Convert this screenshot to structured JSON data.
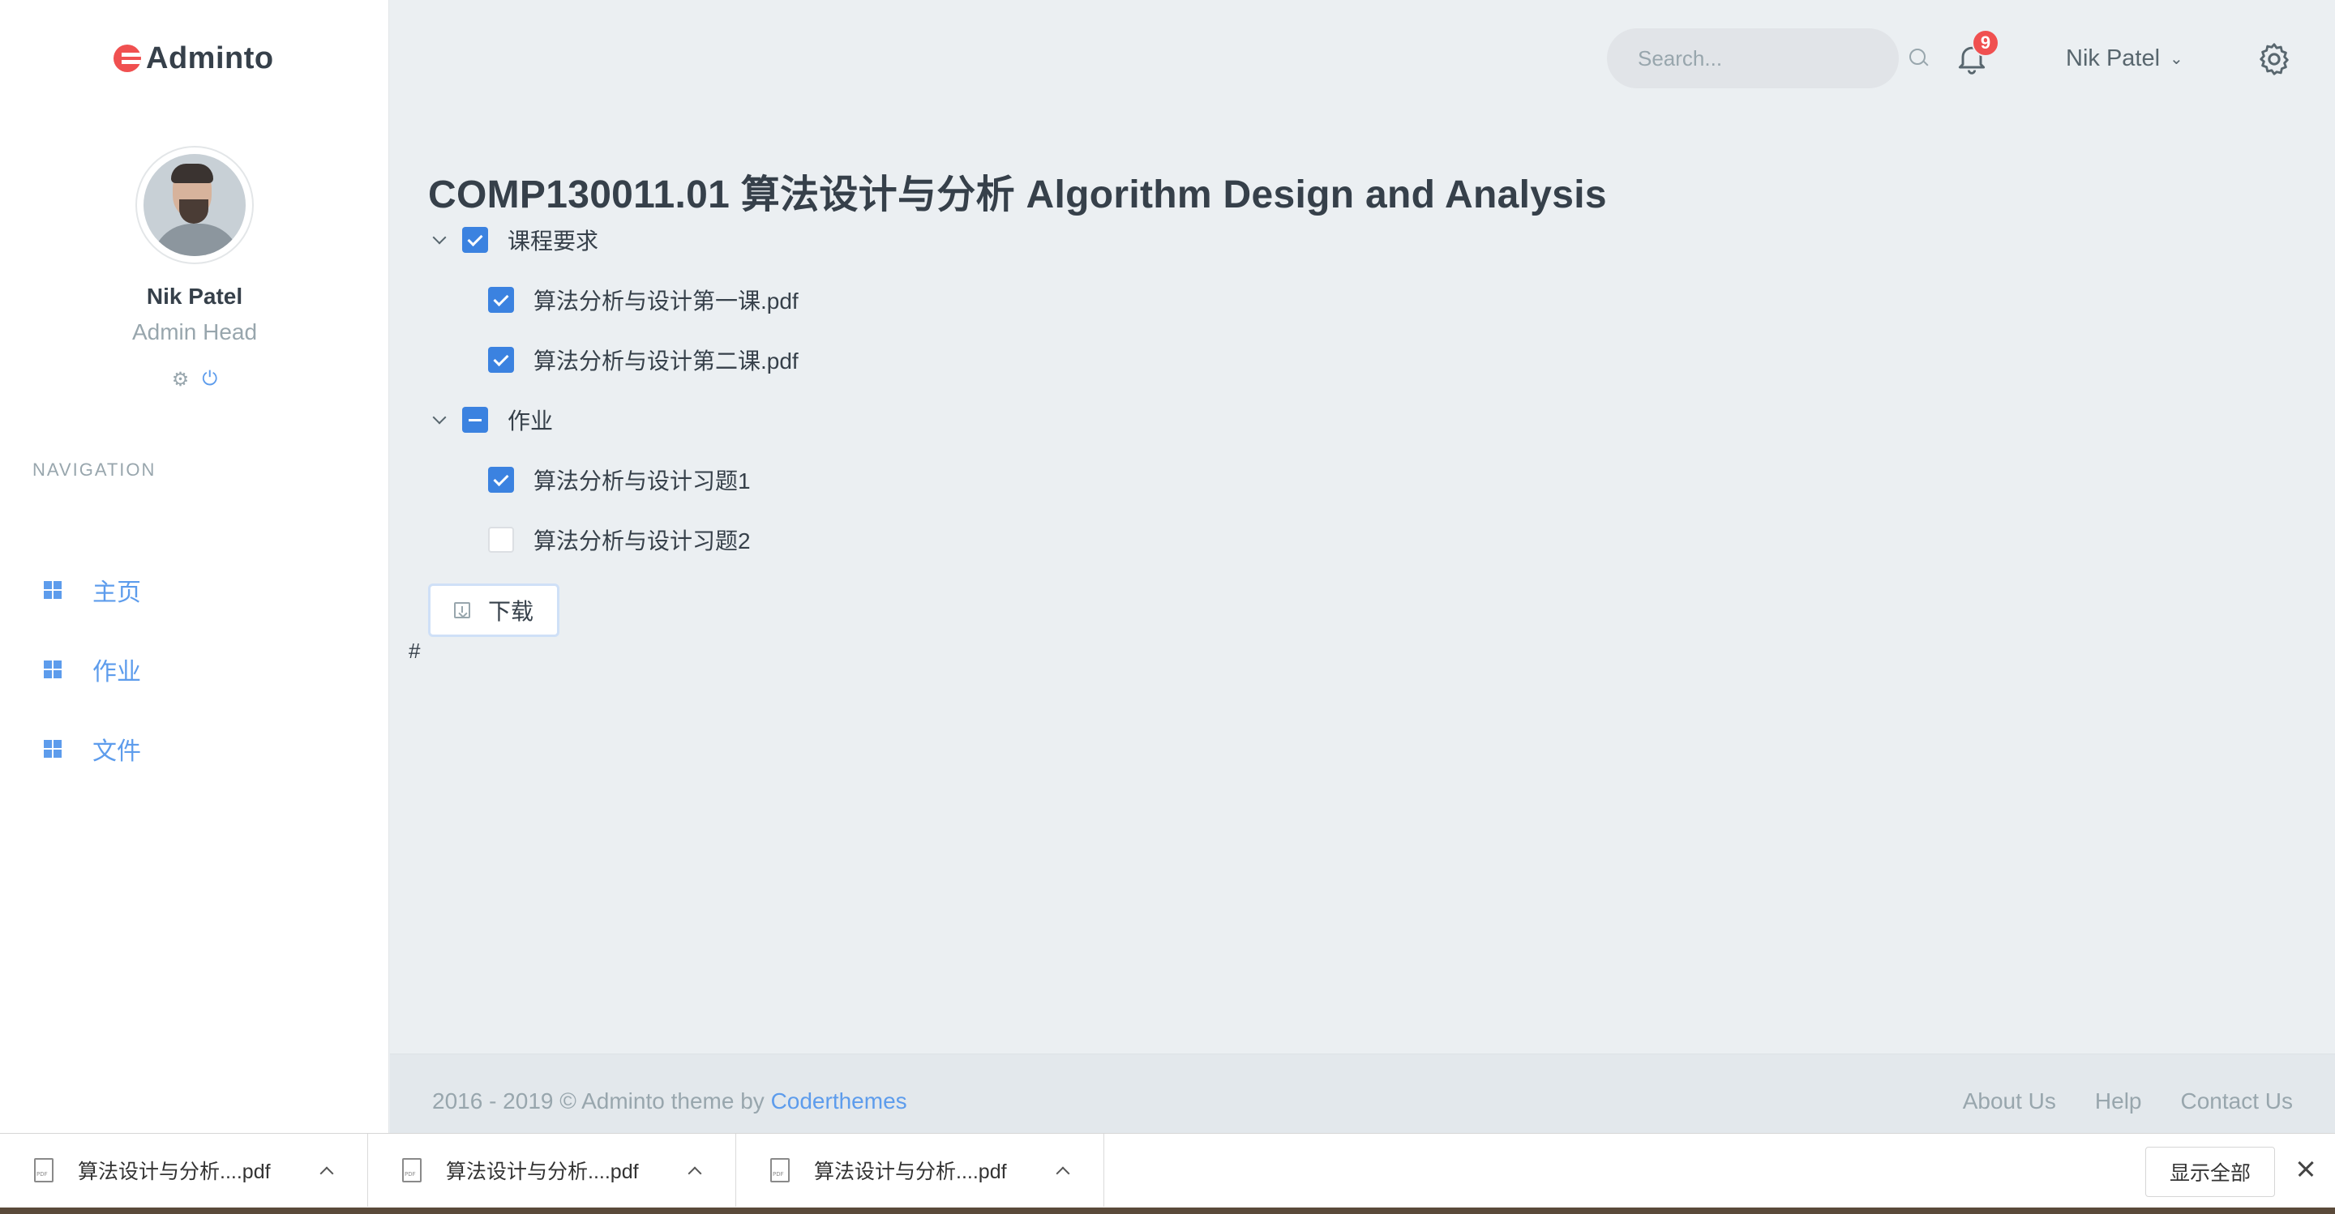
{
  "brand": {
    "name": "Adminto",
    "accent": "#f05050"
  },
  "sidebar": {
    "user": {
      "name": "Nik Patel",
      "role": "Admin Head",
      "icons": [
        "gear-icon",
        "power-icon"
      ]
    },
    "nav_title": "NAVIGATION",
    "items": [
      {
        "label": "主页",
        "icon": "dashboard-icon"
      },
      {
        "label": "作业",
        "icon": "dashboard-icon"
      },
      {
        "label": "文件",
        "icon": "dashboard-icon"
      }
    ]
  },
  "topbar": {
    "search": {
      "placeholder": "Search..."
    },
    "notifications": {
      "count": "9"
    },
    "user_menu": {
      "label": "Nik Patel"
    }
  },
  "main": {
    "title": "COMP130011.01 算法设计与分析 Algorithm Design and Analysis",
    "tree": [
      {
        "label": "课程要求",
        "state": "checked",
        "expanded": true,
        "children": [
          {
            "label": "算法分析与设计第一课.pdf",
            "state": "checked"
          },
          {
            "label": "算法分析与设计第二课.pdf",
            "state": "checked"
          }
        ]
      },
      {
        "label": "作业",
        "state": "partial",
        "expanded": true,
        "children": [
          {
            "label": "算法分析与设计习题1",
            "state": "checked"
          },
          {
            "label": "算法分析与设计习题2",
            "state": "unchecked"
          }
        ]
      }
    ],
    "download_label": "下载",
    "hash": "#"
  },
  "footer": {
    "copyright": "2016 - 2019 © Adminto theme by ",
    "brand_link": "Coderthemes",
    "links": [
      "About Us",
      "Help",
      "Contact Us"
    ]
  },
  "downloads_shelf": {
    "items": [
      {
        "name": "算法设计与分析....pdf"
      },
      {
        "name": "算法设计与分析....pdf"
      },
      {
        "name": "算法设计与分析....pdf"
      }
    ],
    "show_all": "显示全部"
  }
}
